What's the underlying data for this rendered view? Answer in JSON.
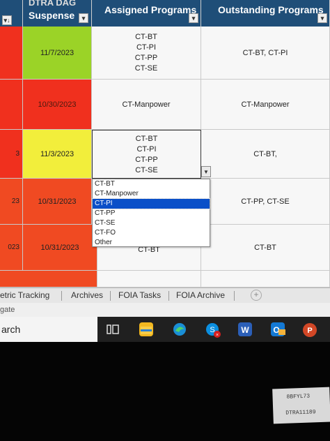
{
  "sheet": {
    "headers": {
      "suspense_top": "DTRA DAG",
      "suspense": "Suspense",
      "assigned": "Assigned Programs",
      "outstanding": "Outstanding Programs"
    },
    "rows": [
      {
        "edge": "",
        "date": "11/7/2023",
        "assigned": [
          "CT-BT",
          "CT-PI",
          "CT-PP",
          "CT-SE"
        ],
        "outstanding": "CT-BT, CT-PI"
      },
      {
        "edge": "",
        "date": "10/30/2023",
        "assigned": [
          "CT-Manpower"
        ],
        "outstanding": "CT-Manpower"
      },
      {
        "edge": "3",
        "date": "11/3/2023",
        "assigned": [
          "CT-BT",
          "CT-PI",
          "CT-PP",
          "CT-SE"
        ],
        "outstanding": "CT-BT,"
      },
      {
        "edge": "23",
        "date": "10/31/2023",
        "assigned": [],
        "outstanding": "CT-PP, CT-SE"
      },
      {
        "edge": "023",
        "date": "10/31/2023",
        "assigned": [
          "CT-BT"
        ],
        "outstanding": "CT-BT"
      }
    ]
  },
  "dropdown": {
    "options": [
      "CT-BT",
      "CT-Manpower",
      "CT-PI",
      "CT-PP",
      "CT-SE",
      "CT-FO",
      "Other"
    ],
    "selected": "CT-PI"
  },
  "tabs": [
    "etric Tracking",
    "Archives",
    "FOIA Tasks",
    "FOIA Archive"
  ],
  "status": {
    "text": "gate"
  },
  "taskbar": {
    "search": "arch"
  },
  "colors": {
    "green": "#9bd327",
    "red": "#f0301e",
    "yellow": "#f2ee3b",
    "orange_red": "#f04a22",
    "header": "#1f4e78",
    "selected": "#0a4fc8"
  },
  "icons": [
    "filter-icon",
    "sort-filter-icon",
    "dropdown-arrow-icon",
    "add-sheet-icon",
    "task-view-icon",
    "file-explorer-icon",
    "edge-icon",
    "skype-icon",
    "word-icon",
    "outlook-icon",
    "powerpoint-icon"
  ],
  "label": {
    "line1": "8BFYL73",
    "line2": "DTRA11189"
  }
}
